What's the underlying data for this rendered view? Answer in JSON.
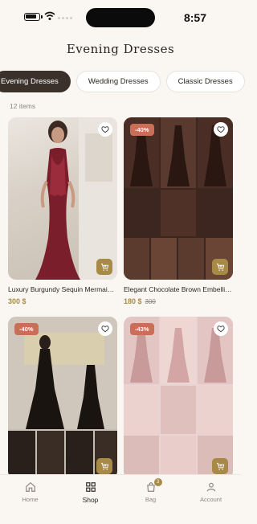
{
  "status_bar": {
    "time": "8:57"
  },
  "header": {
    "title": "Evening Dresses"
  },
  "categories": [
    {
      "label": "Evening Dresses",
      "active": true
    },
    {
      "label": "Wedding Dresses",
      "active": false
    },
    {
      "label": "Classic Dresses",
      "active": false
    }
  ],
  "item_count": "12 items",
  "products": [
    {
      "name": "Luxury Burgundy Sequin Mermaid Evening Dress",
      "price": "300 $",
      "old_price": "",
      "discount": ""
    },
    {
      "name": "Elegant Chocolate Brown Embellished Evening Dress",
      "price": "180 $",
      "old_price": "300",
      "discount": "-40%"
    },
    {
      "name": "",
      "price": "",
      "old_price": "",
      "discount": "-40%"
    },
    {
      "name": "",
      "price": "",
      "old_price": "",
      "discount": "-43%"
    }
  ],
  "tab_bar": {
    "items": [
      {
        "label": "Home",
        "icon": "home-icon"
      },
      {
        "label": "Shop",
        "icon": "grid-icon"
      },
      {
        "label": "Bag",
        "icon": "bag-icon",
        "badge": "3"
      },
      {
        "label": "Account",
        "icon": "account-icon"
      }
    ]
  },
  "colors": {
    "accent": "#a88a47",
    "discount": "#c96e57",
    "active_chip": "#3a312b",
    "background": "#faf7f3"
  }
}
